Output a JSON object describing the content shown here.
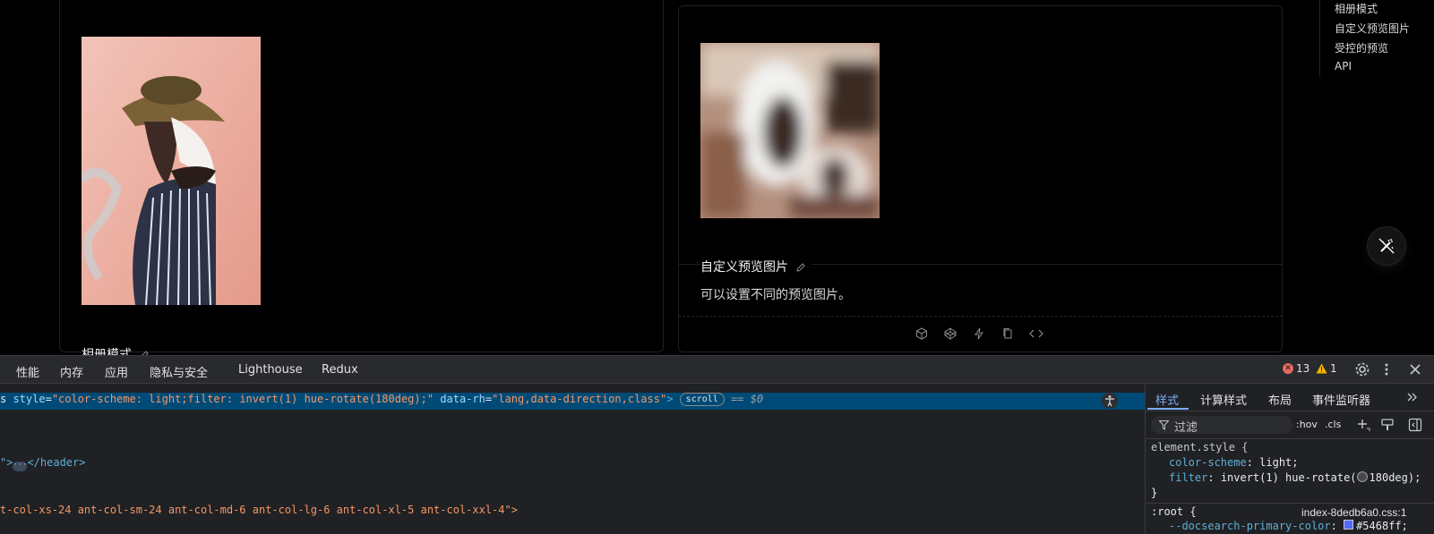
{
  "page": {
    "left_card": {
      "title": "相册模式"
    },
    "right_card": {
      "title": "自定义预览图片",
      "description": "可以设置不同的预览图片。"
    },
    "actions": [
      "codesandbox-icon",
      "codepen-icon",
      "thunder-icon",
      "copy-icon",
      "code-icon"
    ],
    "anchor": [
      "相册模式",
      "自定义预览图片",
      "受控的预览",
      "API"
    ]
  },
  "devtools": {
    "tabs": [
      "性能",
      "内存",
      "应用",
      "隐私与安全",
      "Lighthouse",
      "Redux"
    ],
    "errors": "13",
    "warnings": "1",
    "elements": {
      "selected_prefix": "s ",
      "selected_attr1": "style",
      "selected_val1": "\"color-scheme: light;filter: invert(1) hue-rotate(180deg);\"",
      "selected_attr2": "data-rh",
      "selected_val2": "\"lang,data-direction,class\"",
      "selected_close": ">",
      "scroll_badge": "scroll",
      "eq": "== $0",
      "line2_open": "\">",
      "line2_close": "</header>",
      "line3": "t-col-xs-24 ant-col-sm-24 ant-col-md-6 ant-col-lg-6 ant-col-xl-5 ant-col-xxl-4\">"
    },
    "styles": {
      "tabs": [
        "样式",
        "计算样式",
        "布局",
        "事件监听器"
      ],
      "filter_placeholder": "过滤",
      "hov": ":hov",
      "cls": ".cls",
      "element_style_selector": "element.style {",
      "prop1": "color-scheme",
      "val1": "light;",
      "prop2": "filter",
      "val2a": "invert(1) hue-rotate(",
      "val2b": "180deg);",
      "close_brace": "}",
      "root_selector": ":root {",
      "source": "index-8dedb6a0.css:1",
      "prop3": "--docsearch-primary-color",
      "val3": "#5468ff;",
      "color_swatch": "#5468ff"
    }
  }
}
